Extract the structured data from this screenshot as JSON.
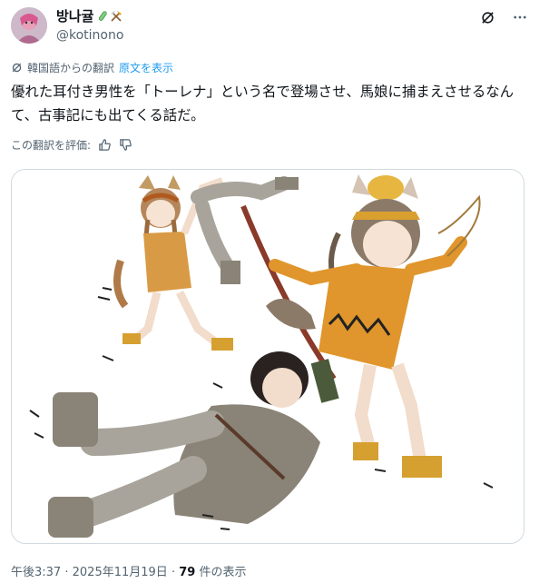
{
  "author": {
    "display_name": "방나귤",
    "handle": "@kotinono",
    "badges": [
      "test-tube-icon",
      "hammer-pick-icon"
    ]
  },
  "header_actions": [
    "grok-icon",
    "more-icon"
  ],
  "translation": {
    "source_label": "韓国語からの翻訳",
    "show_original": "原文を表示"
  },
  "tweet": {
    "text": "優れた耳付き男性を「トーレナ」という名で登場させ、馬娘に捕まえさせるなんて、古事記にも出てくる話だ。"
  },
  "rating": {
    "label": "この翻訳を評価:"
  },
  "media": {
    "alt": "illustration-two-horse-girls-chasing-a-man"
  },
  "meta": {
    "time": "午後3:37",
    "separator": "·",
    "date": "2025年11月19日",
    "views": "79",
    "views_label": "件の表示"
  },
  "colors": {
    "link": "#1d9bf0",
    "secondary": "#536471",
    "text": "#0f1419",
    "border": "#cfd9de"
  }
}
